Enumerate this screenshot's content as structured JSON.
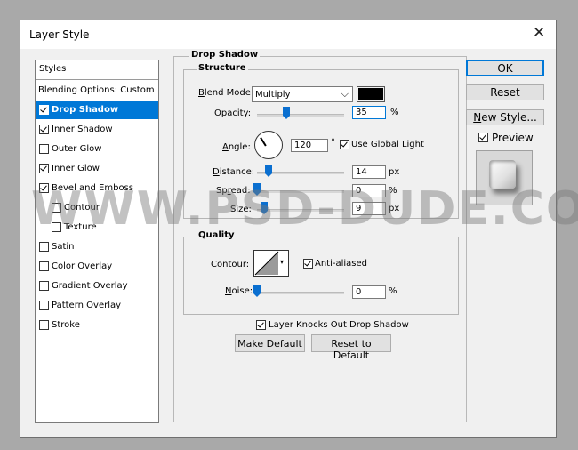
{
  "window": {
    "title": "Layer Style"
  },
  "styles_panel": {
    "header": "Styles",
    "blending_options": "Blending Options: Custom",
    "items": [
      {
        "label": "Drop Shadow",
        "checked": true,
        "selected": true
      },
      {
        "label": "Inner Shadow",
        "checked": true
      },
      {
        "label": "Outer Glow",
        "checked": false
      },
      {
        "label": "Inner Glow",
        "checked": true
      },
      {
        "label": "Bevel and Emboss",
        "checked": true
      },
      {
        "label": "Contour",
        "checked": false
      },
      {
        "label": "Texture",
        "checked": false
      },
      {
        "label": "Satin",
        "checked": false
      },
      {
        "label": "Color Overlay",
        "checked": false
      },
      {
        "label": "Gradient Overlay",
        "checked": false
      },
      {
        "label": "Pattern Overlay",
        "checked": false
      },
      {
        "label": "Stroke",
        "checked": false
      }
    ]
  },
  "drop_shadow": {
    "title": "Drop Shadow",
    "structure": {
      "title": "Structure",
      "blend_mode_label": "Blend Mode:",
      "blend_mode_value": "Multiply",
      "shadow_color": "#000000",
      "opacity_label": "Opacity:",
      "opacity_value": "35",
      "opacity_unit": "%",
      "angle_label": "Angle:",
      "angle_value": "120",
      "angle_unit": "°",
      "use_global_light_label": "Use Global Light",
      "use_global_light": true,
      "distance_label": "Distance:",
      "distance_value": "14",
      "distance_unit": "px",
      "spread_label": "Spread:",
      "spread_value": "0",
      "spread_unit": "%",
      "size_label": "Size:",
      "size_value": "9",
      "size_unit": "px"
    },
    "quality": {
      "title": "Quality",
      "contour_label": "Contour:",
      "anti_aliased_label": "Anti-aliased",
      "anti_aliased": true,
      "noise_label": "Noise:",
      "noise_value": "0",
      "noise_unit": "%"
    },
    "knockout_label": "Layer Knocks Out Drop Shadow",
    "knockout": true,
    "make_default_label": "Make Default",
    "reset_default_label": "Reset to Default"
  },
  "buttons": {
    "ok": "OK",
    "reset": "Reset",
    "new_style": "New Style...",
    "preview_label": "Preview",
    "preview": true
  },
  "watermark": "WWW.PSD-DUDE.COM"
}
